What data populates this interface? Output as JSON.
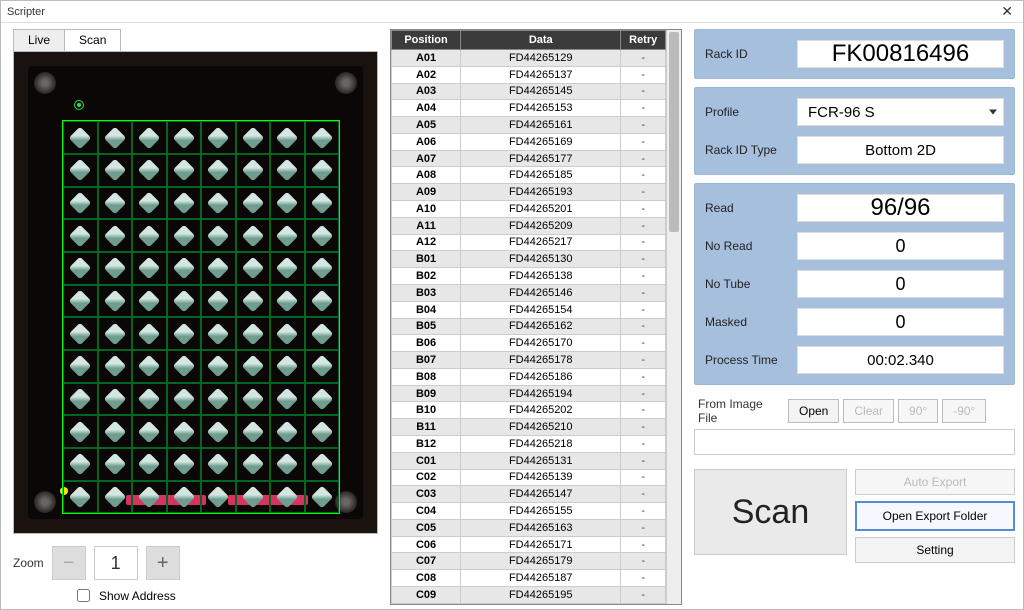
{
  "window": {
    "title": "Scripter"
  },
  "tabs": {
    "live": "Live",
    "scan": "Scan",
    "active": "Scan"
  },
  "zoom": {
    "label": "Zoom",
    "value": "1"
  },
  "show_address": {
    "label": "Show Address",
    "checked": false
  },
  "table": {
    "headers": {
      "position": "Position",
      "data": "Data",
      "retry": "Retry"
    },
    "rows": [
      {
        "pos": "A01",
        "data": "FD44265129",
        "retry": "-"
      },
      {
        "pos": "A02",
        "data": "FD44265137",
        "retry": "-"
      },
      {
        "pos": "A03",
        "data": "FD44265145",
        "retry": "-"
      },
      {
        "pos": "A04",
        "data": "FD44265153",
        "retry": "-"
      },
      {
        "pos": "A05",
        "data": "FD44265161",
        "retry": "-"
      },
      {
        "pos": "A06",
        "data": "FD44265169",
        "retry": "-"
      },
      {
        "pos": "A07",
        "data": "FD44265177",
        "retry": "-"
      },
      {
        "pos": "A08",
        "data": "FD44265185",
        "retry": "-"
      },
      {
        "pos": "A09",
        "data": "FD44265193",
        "retry": "-"
      },
      {
        "pos": "A10",
        "data": "FD44265201",
        "retry": "-"
      },
      {
        "pos": "A11",
        "data": "FD44265209",
        "retry": "-"
      },
      {
        "pos": "A12",
        "data": "FD44265217",
        "retry": "-"
      },
      {
        "pos": "B01",
        "data": "FD44265130",
        "retry": "-"
      },
      {
        "pos": "B02",
        "data": "FD44265138",
        "retry": "-"
      },
      {
        "pos": "B03",
        "data": "FD44265146",
        "retry": "-"
      },
      {
        "pos": "B04",
        "data": "FD44265154",
        "retry": "-"
      },
      {
        "pos": "B05",
        "data": "FD44265162",
        "retry": "-"
      },
      {
        "pos": "B06",
        "data": "FD44265170",
        "retry": "-"
      },
      {
        "pos": "B07",
        "data": "FD44265178",
        "retry": "-"
      },
      {
        "pos": "B08",
        "data": "FD44265186",
        "retry": "-"
      },
      {
        "pos": "B09",
        "data": "FD44265194",
        "retry": "-"
      },
      {
        "pos": "B10",
        "data": "FD44265202",
        "retry": "-"
      },
      {
        "pos": "B11",
        "data": "FD44265210",
        "retry": "-"
      },
      {
        "pos": "B12",
        "data": "FD44265218",
        "retry": "-"
      },
      {
        "pos": "C01",
        "data": "FD44265131",
        "retry": "-"
      },
      {
        "pos": "C02",
        "data": "FD44265139",
        "retry": "-"
      },
      {
        "pos": "C03",
        "data": "FD44265147",
        "retry": "-"
      },
      {
        "pos": "C04",
        "data": "FD44265155",
        "retry": "-"
      },
      {
        "pos": "C05",
        "data": "FD44265163",
        "retry": "-"
      },
      {
        "pos": "C06",
        "data": "FD44265171",
        "retry": "-"
      },
      {
        "pos": "C07",
        "data": "FD44265179",
        "retry": "-"
      },
      {
        "pos": "C08",
        "data": "FD44265187",
        "retry": "-"
      },
      {
        "pos": "C09",
        "data": "FD44265195",
        "retry": "-"
      }
    ]
  },
  "rack": {
    "id_label": "Rack ID",
    "id_value": "FK00816496",
    "profile_label": "Profile",
    "profile_value": "FCR-96  S",
    "type_label": "Rack ID Type",
    "type_value": "Bottom 2D"
  },
  "stats": {
    "read_label": "Read",
    "read_value": "96/96",
    "noread_label": "No Read",
    "noread_value": "0",
    "notube_label": "No Tube",
    "notube_value": "0",
    "masked_label": "Masked",
    "masked_value": "0",
    "ptime_label": "Process Time",
    "ptime_value": "00:02.340"
  },
  "fromfile": {
    "label": "From Image File",
    "open": "Open",
    "clear": "Clear",
    "cw": "90°",
    "ccw": "-90°",
    "path": ""
  },
  "actions": {
    "scan": "Scan",
    "auto_export": "Auto Export",
    "open_export": "Open Export Folder",
    "setting": "Setting"
  }
}
